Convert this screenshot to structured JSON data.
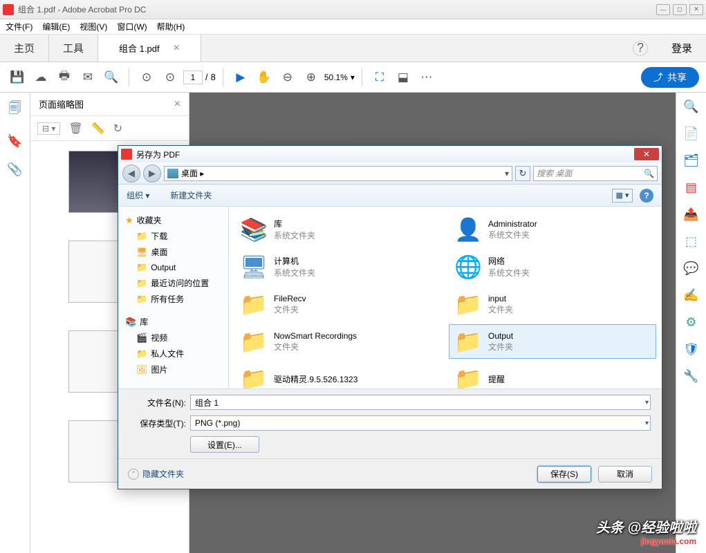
{
  "window": {
    "title": "组合 1.pdf - Adobe Acrobat Pro DC"
  },
  "menubar": [
    "文件(F)",
    "编辑(E)",
    "视图(V)",
    "窗口(W)",
    "帮助(H)"
  ],
  "tabs": {
    "home": "主页",
    "tools": "工具",
    "doc": "组合 1.pdf",
    "login": "登录"
  },
  "toolbar": {
    "page_current": "1",
    "page_sep": "/",
    "page_total": "8",
    "zoom": "50.1%",
    "share_label": "共享"
  },
  "thumb_panel": {
    "title": "页面缩略图"
  },
  "dialog": {
    "title": "另存为 PDF",
    "breadcrumb": "桌面 ▸",
    "search_placeholder": "搜索 桌面",
    "toolbar": {
      "organize": "组织 ▾",
      "new_folder": "新建文件夹"
    },
    "tree": {
      "favorites": "收藏夹",
      "downloads": "下载",
      "desktop": "桌面",
      "output": "Output",
      "recent": "最近访问的位置",
      "all_tasks": "所有任务",
      "library": "库",
      "video": "视频",
      "personal": "私人文件",
      "pictures": "图片"
    },
    "files": [
      {
        "name": "库",
        "type": "系统文件夹",
        "icon": "lib"
      },
      {
        "name": "Administrator",
        "type": "系统文件夹",
        "icon": "user"
      },
      {
        "name": "计算机",
        "type": "系统文件夹",
        "icon": "computer"
      },
      {
        "name": "网络",
        "type": "系统文件夹",
        "icon": "network"
      },
      {
        "name": "FileRecv",
        "type": "文件夹",
        "icon": "folder"
      },
      {
        "name": "input",
        "type": "文件夹",
        "icon": "folder"
      },
      {
        "name": "NowSmart Recordings",
        "type": "文件夹",
        "icon": "folder"
      },
      {
        "name": "Output",
        "type": "文件夹",
        "icon": "folder",
        "selected": true
      },
      {
        "name": "驱动精灵.9.5.526.1323",
        "type": "",
        "icon": "folder"
      },
      {
        "name": "提醒",
        "type": "",
        "icon": "folder"
      }
    ],
    "filename_label": "文件名(N):",
    "filename_value": "组合 1",
    "filetype_label": "保存类型(T):",
    "filetype_value": "PNG (*.png)",
    "settings_btn": "设置(E)...",
    "hide_folders": "隐藏文件夹",
    "save_btn": "保存(S)",
    "cancel_btn": "取消"
  },
  "watermark": {
    "line1": "头条 @经验啦啦",
    "line2": "jingyanla.com"
  }
}
